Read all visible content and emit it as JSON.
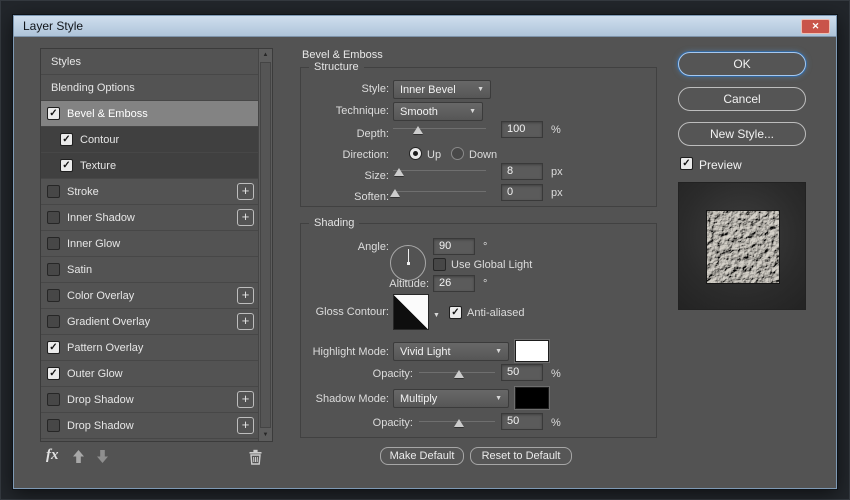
{
  "window": {
    "title": "Layer Style"
  },
  "icons": {
    "close": "✕",
    "check": "✓",
    "plus": "+",
    "dropdown_arrow": "▼",
    "scroll_up": "▲",
    "scroll_down": "▼",
    "fx": "fx"
  },
  "sidebar": {
    "items": [
      {
        "label": "Styles"
      },
      {
        "label": "Blending Options"
      },
      {
        "label": "Bevel & Emboss",
        "checked": true,
        "selected": true
      },
      {
        "label": "Contour",
        "checked": true,
        "sub": true
      },
      {
        "label": "Texture",
        "checked": true,
        "sub": true
      },
      {
        "label": "Stroke",
        "checked": false,
        "plus": true
      },
      {
        "label": "Inner Shadow",
        "checked": false,
        "plus": true
      },
      {
        "label": "Inner Glow",
        "checked": false
      },
      {
        "label": "Satin",
        "checked": false
      },
      {
        "label": "Color Overlay",
        "checked": false,
        "plus": true
      },
      {
        "label": "Gradient Overlay",
        "checked": false,
        "plus": true
      },
      {
        "label": "Pattern Overlay",
        "checked": true
      },
      {
        "label": "Outer Glow",
        "checked": true
      },
      {
        "label": "Drop Shadow",
        "checked": false,
        "plus": true
      },
      {
        "label": "Drop Shadow",
        "checked": false,
        "plus": true
      }
    ]
  },
  "panel": {
    "title": "Bevel & Emboss",
    "structure": {
      "legend": "Structure",
      "style_label": "Style:",
      "style_value": "Inner Bevel",
      "technique_label": "Technique:",
      "technique_value": "Smooth",
      "depth_label": "Depth:",
      "depth_value": "100",
      "depth_unit": "%",
      "direction_label": "Direction:",
      "direction_up": "Up",
      "direction_down": "Down",
      "size_label": "Size:",
      "size_value": "8",
      "size_unit": "px",
      "soften_label": "Soften:",
      "soften_value": "0",
      "soften_unit": "px"
    },
    "shading": {
      "legend": "Shading",
      "angle_label": "Angle:",
      "angle_value": "90",
      "angle_unit": "°",
      "use_global_light_label": "Use Global Light",
      "altitude_label": "Altitude:",
      "altitude_value": "26",
      "altitude_unit": "°",
      "gloss_contour_label": "Gloss Contour:",
      "anti_aliased_label": "Anti-aliased",
      "highlight_mode_label": "Highlight Mode:",
      "highlight_mode_value": "Vivid Light",
      "highlight_opacity_label": "Opacity:",
      "highlight_opacity_value": "50",
      "opacity_unit": "%",
      "shadow_mode_label": "Shadow Mode:",
      "shadow_mode_value": "Multiply",
      "shadow_opacity_label": "Opacity:",
      "shadow_opacity_value": "50"
    },
    "footer": {
      "make_default": "Make Default",
      "reset_to_default": "Reset to Default"
    }
  },
  "actions": {
    "ok": "OK",
    "cancel": "Cancel",
    "new_style": "New Style...",
    "preview_label": "Preview"
  },
  "colors": {
    "highlight_swatch": "#ffffff",
    "shadow_swatch": "#000000",
    "titlebar": "#bcd0e3",
    "close_red": "#c9544a",
    "focus_blue": "#5a9fe6"
  }
}
